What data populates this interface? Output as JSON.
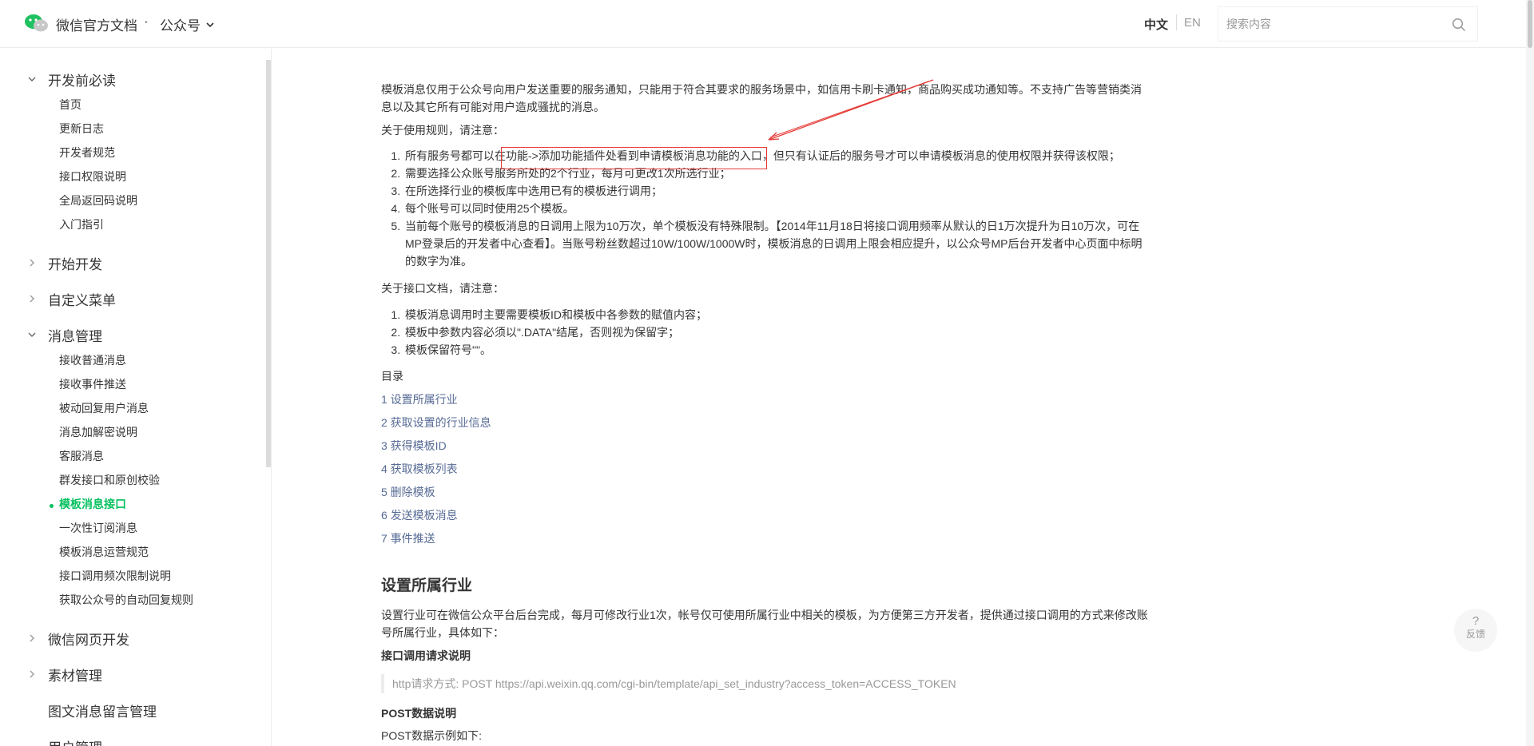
{
  "header": {
    "brand": "微信官方文档",
    "separator": "·",
    "product": "公众号",
    "lang_zh": "中文",
    "lang_en": "EN",
    "search_placeholder": "搜索内容"
  },
  "sidebar": {
    "groups": [
      {
        "label": "开发前必读",
        "expanded": true,
        "items": [
          "首页",
          "更新日志",
          "开发者规范",
          "接口权限说明",
          "全局返回码说明",
          "入门指引"
        ]
      },
      {
        "label": "开始开发",
        "expanded": false
      },
      {
        "label": "自定义菜单",
        "expanded": false
      },
      {
        "label": "消息管理",
        "expanded": true,
        "items": [
          "接收普通消息",
          "接收事件推送",
          "被动回复用户消息",
          "消息加解密说明",
          "客服消息",
          "群发接口和原创校验",
          "模板消息接口",
          "一次性订阅消息",
          "模板消息运营规范",
          "接口调用频次限制说明",
          "获取公众号的自动回复规则"
        ],
        "active_item": "模板消息接口"
      },
      {
        "label": "微信网页开发",
        "expanded": false
      },
      {
        "label": "素材管理",
        "expanded": false
      },
      {
        "label": "图文消息留言管理",
        "expanded": false
      },
      {
        "label": "用户管理",
        "expanded": false
      }
    ]
  },
  "content": {
    "intro": "模板消息仅用于公众号向用户发送重要的服务通知，只能用于符合其要求的服务场景中，如信用卡刷卡通知，商品购买成功通知等。不支持广告等营销类消息以及其它所有可能对用户造成骚扰的消息。",
    "rules_title": "关于使用规则，请注意：",
    "rules": [
      "所有服务号都可以在功能->添加功能插件处看到申请模板消息功能的入口，但只有认证后的服务号才可以申请模板消息的使用权限并获得该权限；",
      "需要选择公众账号服务所处的2个行业，每月可更改1次所选行业；",
      "在所选择行业的模板库中选用已有的模板进行调用；",
      "每个账号可以同时使用25个模板。",
      "当前每个账号的模板消息的日调用上限为10万次，单个模板没有特殊限制。【2014年11月18日将接口调用频率从默认的日1万次提升为日10万次，可在MP登录后的开发者中心查看】。当账号粉丝数超过10W/100W/1000W时，模板消息的日调用上限会相应提升，以公众号MP后台开发者中心页面中标明的数字为准。"
    ],
    "api_title": "关于接口文档，请注意：",
    "api_rules": [
      "模板消息调用时主要需要模板ID和模板中各参数的赋值内容；",
      "模板中参数内容必须以\".DATA\"结尾，否则视为保留字；",
      "模板保留符号\"\"。"
    ],
    "toc_title": "目录",
    "toc": [
      "1 设置所属行业",
      "2 获取设置的行业信息",
      "3 获得模板ID",
      "4 获取模板列表",
      "5 删除模板",
      "6 发送模板消息",
      "7 事件推送"
    ],
    "section_title": "设置所属行业",
    "section_text": "设置行业可在微信公众平台后台完成，每月可修改行业1次，帐号仅可使用所属行业中相关的模板，为方便第三方开发者，提供通过接口调用的方式来修改账号所属行业，具体如下：",
    "request_title": "接口调用请求说明",
    "request_code": "http请求方式: POST https://api.weixin.qq.com/cgi-bin/template/api_set_industry?access_token=ACCESS_TOKEN",
    "post_title": "POST数据说明",
    "post_text": "POST数据示例如下:"
  },
  "feedback": {
    "symbol": "?",
    "label": "反馈"
  },
  "colors": {
    "accent": "#07c160",
    "link": "#576b95",
    "annotation": "#e53935"
  }
}
